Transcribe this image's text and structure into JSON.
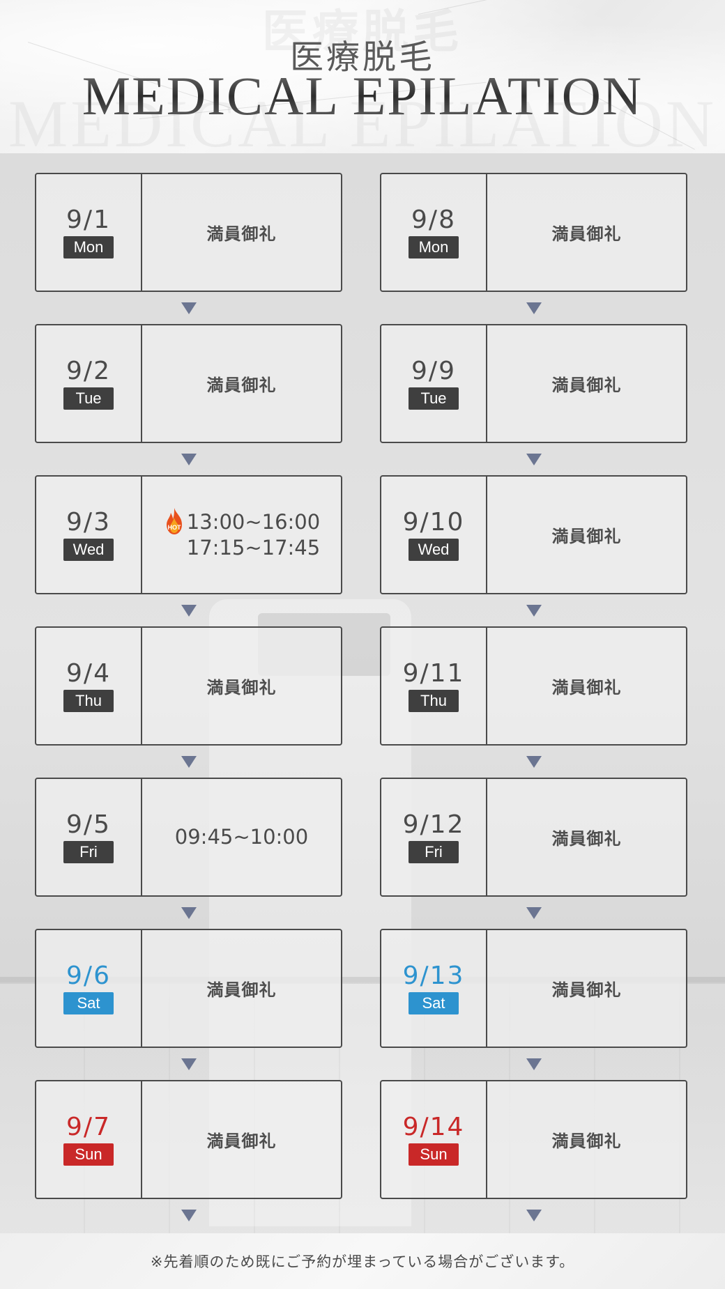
{
  "header": {
    "title_ja": "医療脱毛",
    "title_en": "MEDICAL EPILATION"
  },
  "colors": {
    "weekday_badge": "#3f3f3f",
    "saturday": "#2d93cf",
    "sunday": "#c92828",
    "arrow": "#6b7591",
    "hot_flame": "#e8501c"
  },
  "schedule": {
    "left": [
      {
        "date": "9/1",
        "weekday": "Mon",
        "type": "weekday",
        "status": "満員御礼"
      },
      {
        "date": "9/2",
        "weekday": "Tue",
        "type": "weekday",
        "status": "満員御礼"
      },
      {
        "date": "9/3",
        "weekday": "Wed",
        "type": "weekday",
        "hot": true,
        "hot_label": "HOT",
        "times": [
          "13:00~16:00",
          "17:15~17:45"
        ]
      },
      {
        "date": "9/4",
        "weekday": "Thu",
        "type": "weekday",
        "status": "満員御礼"
      },
      {
        "date": "9/5",
        "weekday": "Fri",
        "type": "weekday",
        "times": [
          "09:45~10:00"
        ]
      },
      {
        "date": "9/6",
        "weekday": "Sat",
        "type": "sat",
        "status": "満員御礼"
      },
      {
        "date": "9/7",
        "weekday": "Sun",
        "type": "sun",
        "status": "満員御礼"
      }
    ],
    "right": [
      {
        "date": "9/8",
        "weekday": "Mon",
        "type": "weekday",
        "status": "満員御礼"
      },
      {
        "date": "9/9",
        "weekday": "Tue",
        "type": "weekday",
        "status": "満員御礼"
      },
      {
        "date": "9/10",
        "weekday": "Wed",
        "type": "weekday",
        "status": "満員御礼"
      },
      {
        "date": "9/11",
        "weekday": "Thu",
        "type": "weekday",
        "status": "満員御礼"
      },
      {
        "date": "9/12",
        "weekday": "Fri",
        "type": "weekday",
        "status": "満員御礼"
      },
      {
        "date": "9/13",
        "weekday": "Sat",
        "type": "sat",
        "status": "満員御礼"
      },
      {
        "date": "9/14",
        "weekday": "Sun",
        "type": "sun",
        "status": "満員御礼"
      }
    ]
  },
  "footer": {
    "note": "※先着順のため既にご予約が埋まっている場合がございます。"
  }
}
